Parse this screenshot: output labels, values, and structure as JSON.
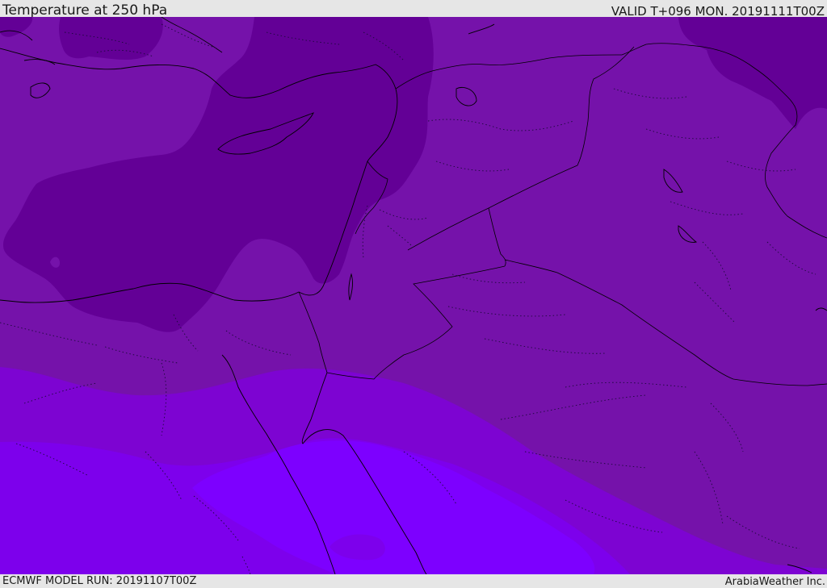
{
  "header": {
    "title": "Temperature at 250 hPa",
    "valid_time": "VALID T+096 MON. 20191111T00Z"
  },
  "footer": {
    "model_run": "ECMWF MODEL RUN: 20191107T00Z",
    "credit": "ArabiaWeather Inc."
  },
  "palette": {
    "coldest": "#630096",
    "cold": "#7512aa",
    "mid": "#7d04d2",
    "warm": "#7d00ec",
    "warmest": "#7d00ff",
    "boundaries": "#000000"
  }
}
